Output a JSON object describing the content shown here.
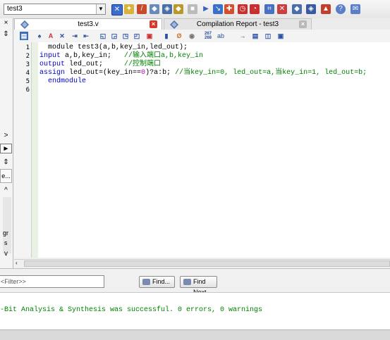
{
  "toolbar": {
    "project_select": "test3",
    "icons": [
      "chip-planner-icon",
      "pin-planner-icon",
      "magic-wand-icon",
      "settings-icon",
      "assignment-icon",
      "sim-icon",
      "stop-icon",
      "start-compile-icon",
      "analysis-icon",
      "synthesis-icon",
      "timing-icon",
      "clock-icon",
      "netlist-icon",
      "rtl-icon",
      "programmer-icon",
      "chip-icon",
      "signaltap-icon",
      "help-icon",
      "feedback-icon"
    ]
  },
  "left_panel": {
    "close_glyph": "×",
    "pin_glyph": "⇕",
    "scroll_right": ">",
    "scroll_left": "◄",
    "scroll_right_filled": "►",
    "ellipsis_button": "e...",
    "scroll_up": "^",
    "scroll_down": "v",
    "fragment_1": "gr",
    "fragment_2": "s"
  },
  "tabs": [
    {
      "label": "test3.v",
      "close": "×"
    },
    {
      "label": "Compilation Report - test3",
      "close": "×"
    }
  ],
  "editor_toolbar": {
    "button_245": "267\n268",
    "button_ab": "ab"
  },
  "editor": {
    "line_numbers": [
      "1",
      "2",
      "3",
      "4",
      "5",
      "6"
    ],
    "lines": [
      {
        "plain": "  module test3(a,b,key_in,led_out);"
      },
      {
        "kw": "input",
        "plain": " a,b,key_in;   ",
        "comment": "//输入端口a,b,key_in"
      },
      {
        "kw": "output",
        "plain": " led_out;     ",
        "comment": "//控制端口"
      },
      {
        "kw": "assign",
        "plain": " led_out=(key_in==",
        "num": "0",
        "plain2": ")?a:b; ",
        "comment": "//当key_in=0, led_out=a,当key_in=1, led_out=b;"
      },
      {
        "plain": "  endmodule"
      },
      {
        "plain": ""
      }
    ]
  },
  "find": {
    "filter_placeholder": "<Filter>>",
    "find_button": "Find...",
    "find_next_button": "Find Next"
  },
  "messages": {
    "text": "-Bit Analysis & Synthesis was successful. 0 errors, 0 warnings"
  }
}
